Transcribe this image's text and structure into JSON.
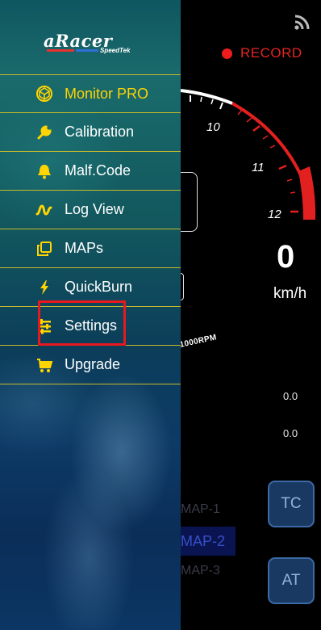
{
  "status_bar": {
    "record_label": "RECORD",
    "record_color": "#ee1c1c",
    "signal_icon": "signal-wifi-icon"
  },
  "gauge": {
    "tachometer_labels": [
      "10",
      "11",
      "12"
    ],
    "tachometer_unit": "1000RPM",
    "speed_value": "0",
    "speed_unit": "km/h",
    "redline_color": "#e32020"
  },
  "readouts": {
    "value_1": "0.0",
    "value_2": "0.0"
  },
  "maps": {
    "items": [
      "MAP-1",
      "MAP-2",
      "MAP-3"
    ],
    "selected": "MAP-2"
  },
  "controls": {
    "tc_label": "TC",
    "at_label": "AT"
  },
  "drawer": {
    "logo": {
      "brand": "aRacer",
      "sub": "SpeedTek"
    },
    "items": [
      {
        "label": "Monitor PRO",
        "icon": "cube-outline-icon",
        "accent": true
      },
      {
        "label": "Calibration",
        "icon": "wrench-icon",
        "accent": false
      },
      {
        "label": "Malf.Code",
        "icon": "bell-icon",
        "accent": false
      },
      {
        "label": "Log View",
        "icon": "waveform-icon",
        "accent": false
      },
      {
        "label": "MAPs",
        "icon": "copy-icon",
        "accent": false
      },
      {
        "label": "QuickBurn",
        "icon": "lightning-icon",
        "accent": false
      },
      {
        "label": "Settings",
        "icon": "sliders-icon",
        "accent": false,
        "highlighted": true
      },
      {
        "label": "Upgrade",
        "icon": "cart-icon",
        "accent": false
      }
    ],
    "divider_color": "#c9b92a",
    "icon_color": "#ffd400",
    "highlight_color": "#e8181e"
  }
}
